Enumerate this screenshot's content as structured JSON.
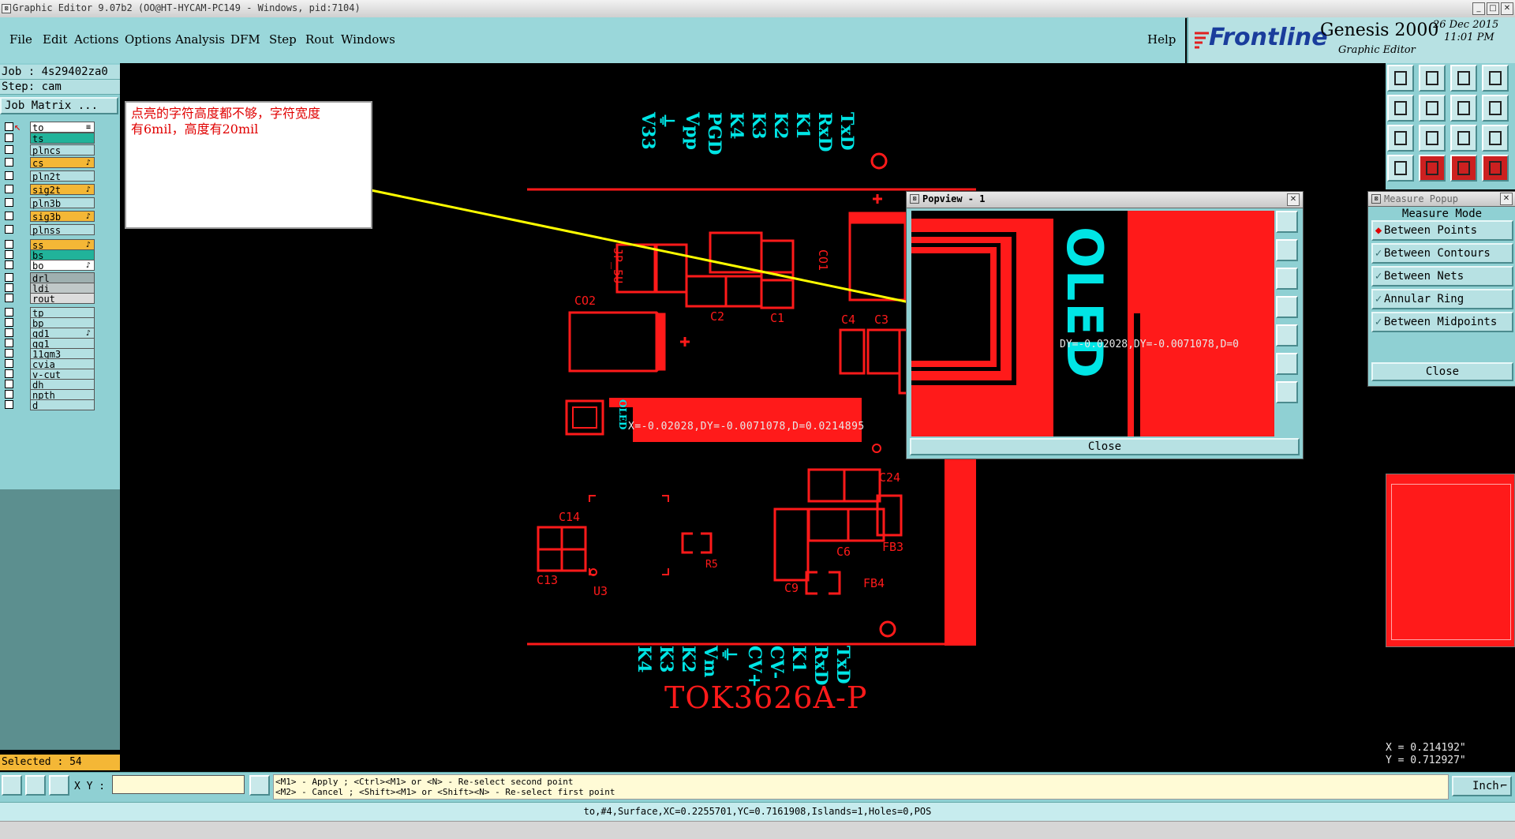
{
  "window": {
    "title": "Graphic Editor 9.07b2 (OO@HT-HYCAM-PC149 - Windows, pid:7104)",
    "minimize": "_",
    "maximize": "□",
    "close": "✕"
  },
  "menu": {
    "items": [
      "File",
      "Edit",
      "Actions",
      "Options",
      "Analysis",
      "DFM",
      "Step",
      "Rout",
      "Windows"
    ],
    "help": "Help"
  },
  "brand": {
    "company": "Frontline",
    "product": "Genesis 2000",
    "subtitle": "Graphic Editor",
    "date": "26 Dec 2015",
    "time": "11:01 PM"
  },
  "left_panel": {
    "job": "Job : 4s29402za0",
    "step": "Step: cam",
    "job_matrix_button": "Job Matrix ...",
    "layers": [
      {
        "name": "to",
        "color": "#ffffff",
        "tag": "≡"
      },
      {
        "name": "ts",
        "color": "#21b39a",
        "tag": ""
      },
      {
        "name": "plncs",
        "color": "#b4e0e2",
        "tag": ""
      },
      {
        "name": "cs",
        "color": "#f4b736",
        "tag": "♪"
      },
      {
        "name": "pln2t",
        "color": "#b4e0e2",
        "tag": ""
      },
      {
        "name": "sig2t",
        "color": "#f4b736",
        "tag": "♪"
      },
      {
        "name": "pln3b",
        "color": "#b4e0e2",
        "tag": ""
      },
      {
        "name": "sig3b",
        "color": "#f4b736",
        "tag": "♪"
      },
      {
        "name": "plnss",
        "color": "#b4e0e2",
        "tag": ""
      },
      {
        "name": "ss",
        "color": "#f4b736",
        "tag": "♪"
      },
      {
        "name": "bs",
        "color": "#21b39a",
        "tag": ""
      },
      {
        "name": "bo",
        "color": "#ffffff",
        "tag": "♪"
      },
      {
        "name": "drl",
        "color": "#9fb0b0",
        "tag": ""
      },
      {
        "name": "ldi",
        "color": "#c0c8c8",
        "tag": ""
      },
      {
        "name": "rout",
        "color": "#dcdcdc",
        "tag": ""
      },
      {
        "name": "tp",
        "color": "#b4e0e2",
        "tag": ""
      },
      {
        "name": "bp",
        "color": "#b4e0e2",
        "tag": ""
      },
      {
        "name": "gd1",
        "color": "#b4e0e2",
        "tag": "♪"
      },
      {
        "name": "gg1",
        "color": "#b4e0e2",
        "tag": ""
      },
      {
        "name": "11gm3",
        "color": "#b4e0e2",
        "tag": ""
      },
      {
        "name": "cvia",
        "color": "#b4e0e2",
        "tag": ""
      },
      {
        "name": "v-cut",
        "color": "#b4e0e2",
        "tag": ""
      },
      {
        "name": "dh",
        "color": "#b4e0e2",
        "tag": ""
      },
      {
        "name": "npth",
        "color": "#b4e0e2",
        "tag": ""
      },
      {
        "name": "d",
        "color": "#b4e0e2",
        "tag": ""
      }
    ],
    "selected": "Selected : 54"
  },
  "note": {
    "line1": "点亮的字符高度都不够，字符宽度",
    "line2": "有6mil，高度有20mil"
  },
  "pcb": {
    "top_signals": [
      "V33",
      "⏚",
      "Vpp",
      "PGD",
      "K4",
      "K3",
      "K2",
      "K1",
      "RxD",
      "TxD"
    ],
    "bottom_signals": [
      "K4",
      "K3",
      "K2",
      "Vm",
      "⏚",
      "CV+",
      "CV-",
      "K1",
      "RxD",
      "TxD"
    ],
    "board_name": "TOK3626A-P",
    "refdes": {
      "jp": "JP_5U",
      "co2": "CO2",
      "co1": "CO1",
      "c1": "C1",
      "c2": "C2",
      "c3": "C3",
      "c4": "C4",
      "c24": "C24",
      "c6": "C6",
      "fb3": "FB3",
      "fb4": "FB4",
      "c9": "C9",
      "r5": "R5",
      "c14": "C14",
      "c13": "C13",
      "u3": "U3",
      "oled_small": "OLED"
    },
    "measure_readout": "X=-0.02028,DY=-0.0071078,D=0.0214895"
  },
  "popview": {
    "title": "Popview - 1",
    "text": "OLED",
    "readout": "DY=-0.02028,DY=-0.0071078,D=0",
    "close": "Close"
  },
  "measure_popup": {
    "title": "Measure Popup",
    "mode_label": "Measure Mode",
    "options": [
      "Between Points",
      "Between Contours",
      "Between Nets",
      "Annular Ring",
      "Between Midpoints"
    ],
    "selected_index": 0,
    "close": "Close"
  },
  "coords": {
    "x": "X = 0.214192\"",
    "y": "Y = 0.712927\""
  },
  "bottom": {
    "xy_label": "X Y :",
    "xy_value": "",
    "hint_line1": "<M1> - Apply  ; <Ctrl><M1> or <N> - Re-select second point",
    "hint_line2": "<M2> - Cancel ; <Shift><M1> or <Shift><N> - Re-select first point",
    "units": "Inch",
    "status": "to,#4,Surface,XC=0.2255701,YC=0.7161908,Islands=1,Holes=0,POS"
  },
  "colors": {
    "copper": "#ff1a1a",
    "silkscreen": "#00e5e5",
    "annotation_arrow": "#ffff00",
    "panel": "#8fd0d3"
  }
}
